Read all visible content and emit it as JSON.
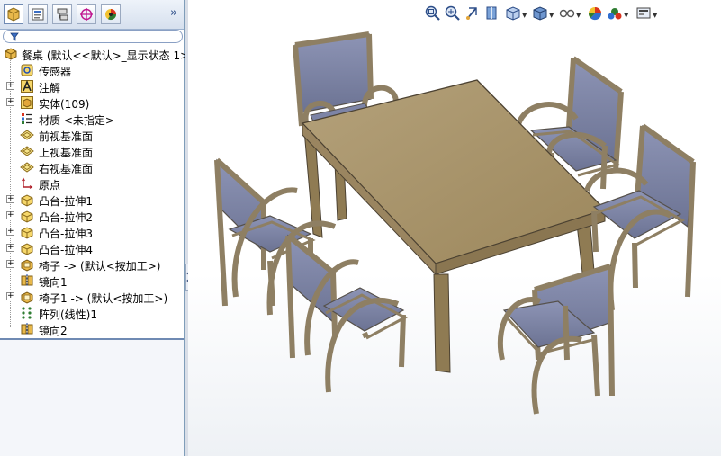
{
  "feature_tree": {
    "tabs": [
      {
        "name": "featuremanager-tab"
      },
      {
        "name": "propertymanager-tab"
      },
      {
        "name": "configurationmanager-tab"
      },
      {
        "name": "dimxpert-tab"
      },
      {
        "name": "display-manager-tab"
      }
    ],
    "expand_glyph": "»",
    "root": "餐桌  (默认<<默认>_显示状态 1>",
    "items": [
      {
        "label": "传感器",
        "icon": "sensor-icon",
        "expandable": false
      },
      {
        "label": "注解",
        "icon": "annotation-icon",
        "expandable": true
      },
      {
        "label": "实体(109)",
        "icon": "solid-bodies-icon",
        "expandable": true
      },
      {
        "label": "材质 <未指定>",
        "icon": "material-icon",
        "expandable": false
      },
      {
        "label": "前视基准面",
        "icon": "plane-icon",
        "expandable": false
      },
      {
        "label": "上视基准面",
        "icon": "plane-icon",
        "expandable": false
      },
      {
        "label": "右视基准面",
        "icon": "plane-icon",
        "expandable": false
      },
      {
        "label": "原点",
        "icon": "origin-icon",
        "expandable": false
      },
      {
        "label": "凸台-拉伸1",
        "icon": "extrude-icon",
        "expandable": true
      },
      {
        "label": "凸台-拉伸2",
        "icon": "extrude-icon",
        "expandable": true
      },
      {
        "label": "凸台-拉伸3",
        "icon": "extrude-icon",
        "expandable": true
      },
      {
        "label": "凸台-拉伸4",
        "icon": "extrude-icon",
        "expandable": true
      },
      {
        "label": "椅子 -> (默认<按加工>)",
        "icon": "part-icon",
        "expandable": true
      },
      {
        "label": "镜向1",
        "icon": "mirror-icon",
        "expandable": false
      },
      {
        "label": "椅子1 -> (默认<按加工>)",
        "icon": "part-icon",
        "expandable": true
      },
      {
        "label": "阵列(线性)1",
        "icon": "linear-pattern-icon",
        "expandable": false
      },
      {
        "label": "镜向2",
        "icon": "mirror-icon",
        "expandable": false
      }
    ]
  },
  "heads_up_toolbar": [
    {
      "name": "zoom-to-fit-icon"
    },
    {
      "name": "zoom-to-area-icon"
    },
    {
      "name": "previous-view-icon"
    },
    {
      "name": "section-view-icon"
    },
    {
      "name": "view-orientation-icon",
      "dropdown": true
    },
    {
      "name": "display-style-icon",
      "dropdown": true
    },
    {
      "name": "hide-show-items-icon",
      "dropdown": true
    },
    {
      "name": "edit-appearance-icon"
    },
    {
      "name": "apply-scene-icon",
      "dropdown": true
    },
    {
      "name": "view-settings-icon",
      "dropdown": true
    }
  ],
  "colors": {
    "table_wood": "#a8946a",
    "chair_frame": "#8e7f63",
    "chair_fabric": "#7d84a6",
    "tree_accent": "#6f8ab3"
  }
}
